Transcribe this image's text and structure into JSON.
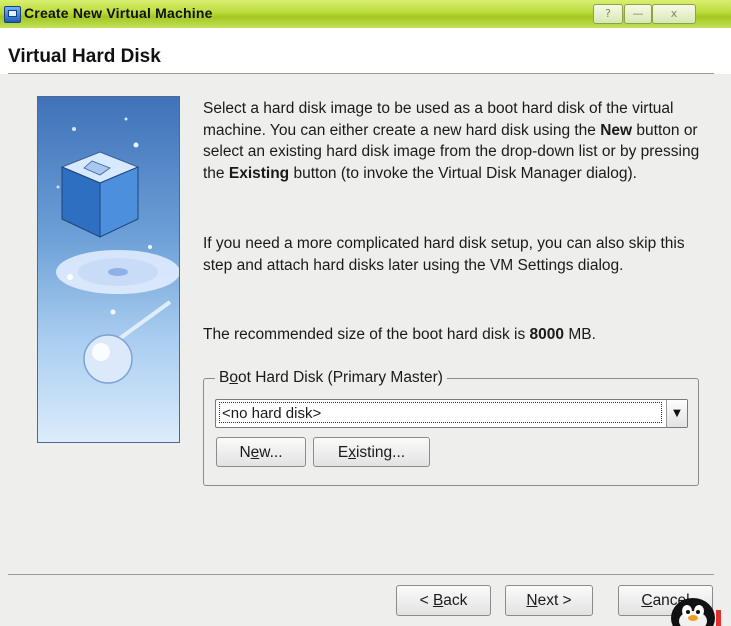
{
  "window": {
    "title": "Create New Virtual Machine",
    "controls": {
      "help": "?",
      "minimize": "—",
      "close": "x"
    }
  },
  "header": {
    "title": "Virtual Hard Disk"
  },
  "text": {
    "para1_a": "Select a hard disk image to be used as a boot hard disk of the virtual machine. You can either create a new hard disk using the ",
    "para1_new": "New",
    "para1_b": " button or select an existing hard disk image from the drop-down list or by pressing the ",
    "para1_existing": "Existing",
    "para1_c": " button (to invoke the Virtual Disk Manager dialog).",
    "para2": "If you need a more complicated hard disk setup, you can also skip this step and attach hard disks later using the VM Settings dialog.",
    "para3_a": "The recommended size of the boot hard disk is ",
    "para3_size": "8000",
    "para3_b": " MB."
  },
  "group": {
    "title_pre": "B",
    "title_mn": "o",
    "title_post": "ot Hard Disk (Primary Master)",
    "combo_value": "<no hard disk>",
    "new_pre": "N",
    "new_mn": "e",
    "new_post": "w...",
    "existing_pre": "E",
    "existing_mn": "x",
    "existing_post": "isting..."
  },
  "footer": {
    "back_pre": "< ",
    "back_mn": "B",
    "back_post": "ack",
    "next_mn": "N",
    "next_post": "ext >",
    "cancel_mn": "C",
    "cancel_post": "ancel"
  },
  "colors": {
    "titlebar": "#b9db3a",
    "image_top": "#3f72b8",
    "image_bottom": "#dcecfb"
  }
}
